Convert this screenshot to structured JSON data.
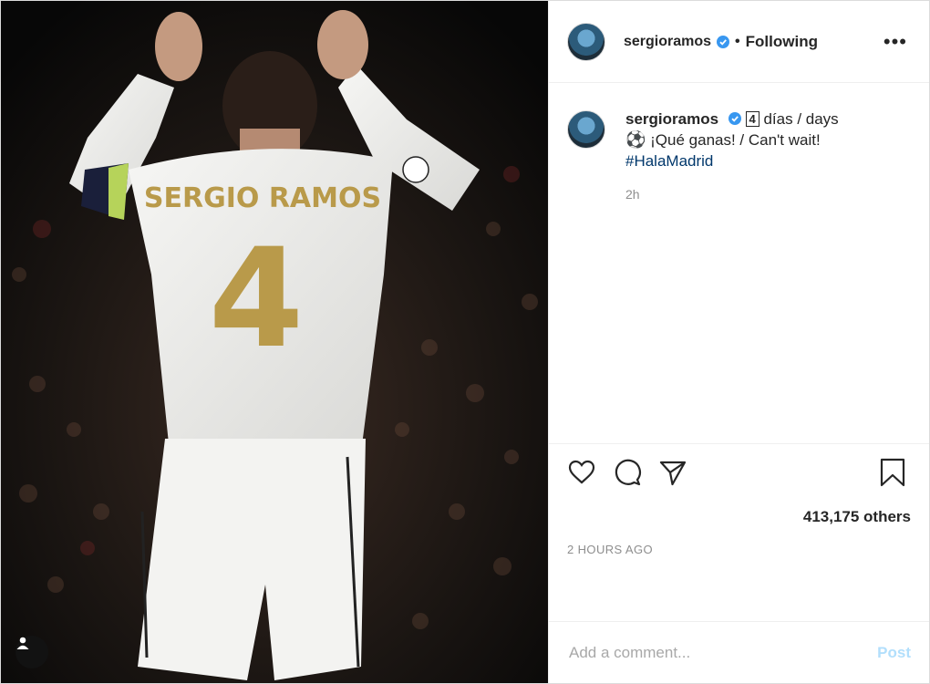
{
  "photo": {
    "jersey_name": "SERGIO RAMOS",
    "jersey_number": "4",
    "tag_icon": "user-tag-icon"
  },
  "header": {
    "username": "sergioramos",
    "verified_icon": "verified-badge-icon",
    "separator": "•",
    "follow_status": "Following",
    "more_icon": "more-options-icon"
  },
  "caption": {
    "username": "sergioramos",
    "keycap": "4",
    "line1_rest": " días / days",
    "ball": "⚽",
    "line2_rest": " ¡Qué ganas! / Can't wait!",
    "hashtag": "#HalaMadrid",
    "time": "2h"
  },
  "actions": {
    "like_icon": "heart-icon",
    "comment_icon": "comment-icon",
    "share_icon": "paper-plane-icon",
    "save_icon": "bookmark-icon"
  },
  "likes_text": "413,175 others",
  "posted_ago": "2 HOURS AGO",
  "comment_box": {
    "placeholder": "Add a comment...",
    "post_label": "Post"
  },
  "colors": {
    "link": "#00376b",
    "post_button_disabled": "#b2dffc",
    "muted": "#8e8e8e",
    "jersey_gold": "#b99a4a"
  }
}
